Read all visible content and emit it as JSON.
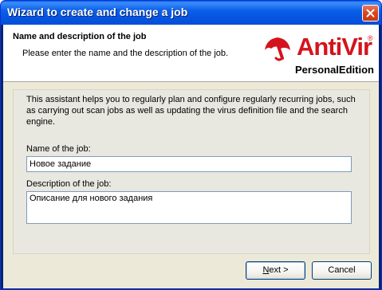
{
  "window": {
    "title": "Wizard to create and change a job"
  },
  "header": {
    "title": "Name and description of the job",
    "subtitle": "Please enter the name and the description of the job.",
    "logo": {
      "brand": "AntiVir",
      "registered": "®",
      "edition": "PersonalEdition",
      "icon": "antivir-umbrella-icon",
      "brand_color": "#d4141c"
    }
  },
  "body": {
    "intro": "This assistant helps you to regularly plan and configure regularly recurring jobs, such as carrying out scan jobs as well as updating the virus definition file and the search engine.",
    "name_label": "Name of the job:",
    "name_value": "Новое задание",
    "description_label": "Description of the job:",
    "description_value": "Описание для нового задания"
  },
  "buttons": {
    "next_accel": "N",
    "next_rest": "ext >",
    "cancel": "Cancel"
  }
}
